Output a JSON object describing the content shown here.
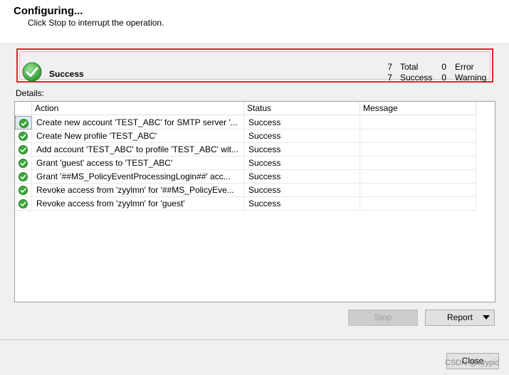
{
  "header": {
    "title": "Configuring...",
    "subtitle": "Click Stop to interrupt the operation."
  },
  "summary": {
    "status_label": "Success",
    "total_count": "7",
    "total_label": "Total",
    "success_count": "7",
    "success_label": "Success",
    "error_count": "0",
    "error_label": "Error",
    "warning_count": "0",
    "warning_label": "Warning",
    "status_icon": "check-circle-icon"
  },
  "details": {
    "label": "Details:",
    "columns": [
      "Action",
      "Status",
      "Message"
    ],
    "rows": [
      {
        "action": "Create new account 'TEST_ABC' for SMTP server '...",
        "status": "Success",
        "message": "",
        "icon": "check-circle-icon"
      },
      {
        "action": "Create New profile 'TEST_ABC'",
        "status": "Success",
        "message": "",
        "icon": "check-circle-icon"
      },
      {
        "action": "Add account 'TEST_ABC' to profile 'TEST_ABC' wit...",
        "status": "Success",
        "message": "",
        "icon": "check-circle-icon"
      },
      {
        "action": "Grant 'guest' access to 'TEST_ABC'",
        "status": "Success",
        "message": "",
        "icon": "check-circle-icon"
      },
      {
        "action": "Grant '##MS_PolicyEventProcessingLogin##' acc...",
        "status": "Success",
        "message": "",
        "icon": "check-circle-icon"
      },
      {
        "action": "Revoke access from 'zyylmn' for '##MS_PolicyEve...",
        "status": "Success",
        "message": "",
        "icon": "check-circle-icon"
      },
      {
        "action": "Revoke access from 'zyylmn' for 'guest'",
        "status": "Success",
        "message": "",
        "icon": "check-circle-icon"
      }
    ]
  },
  "buttons": {
    "stop": "Stop",
    "report": "Report",
    "close": "Close"
  },
  "watermark": "CSDN @zyypic",
  "colors": {
    "highlight_border": "#e0262a",
    "success_green": "#3aa83a",
    "disabled_button": "#cccccc"
  }
}
